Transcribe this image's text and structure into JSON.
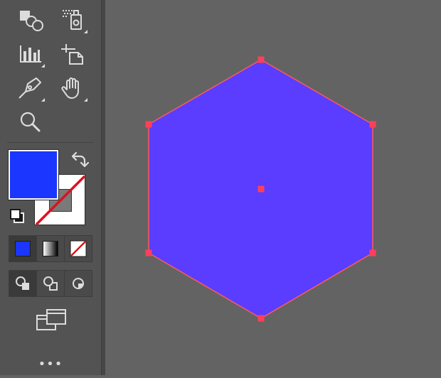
{
  "toolbar": {
    "tools": [
      {
        "name": "shape-builder-tool",
        "icon": "shape-builder-icon"
      },
      {
        "name": "symbol-sprayer-tool",
        "icon": "symbol-sprayer-icon"
      },
      {
        "name": "column-graph-tool",
        "icon": "column-graph-icon"
      },
      {
        "name": "artboard-tool",
        "icon": "artboard-icon"
      },
      {
        "name": "pen-tool",
        "icon": "pen-icon"
      },
      {
        "name": "hand-tool",
        "icon": "hand-icon"
      },
      {
        "name": "zoom-tool",
        "icon": "zoom-icon"
      }
    ],
    "fill_color": "#1a36ff",
    "stroke": "none",
    "swap_icon": "swap-arrow-icon",
    "default_colors_icon": "default-fill-stroke-icon",
    "color_modes": [
      "color",
      "gradient",
      "none"
    ],
    "draw_modes": [
      "draw-normal",
      "draw-behind",
      "draw-inside"
    ],
    "screen_mode_icon": "screen-mode-icon",
    "more_label": "•••"
  },
  "canvas": {
    "background": "#636363",
    "shape": {
      "type": "hexagon",
      "fill": "#5a3dff",
      "stroke": "#ff5a5a",
      "anchor_color": "#ff3f5a",
      "selected": true
    }
  }
}
